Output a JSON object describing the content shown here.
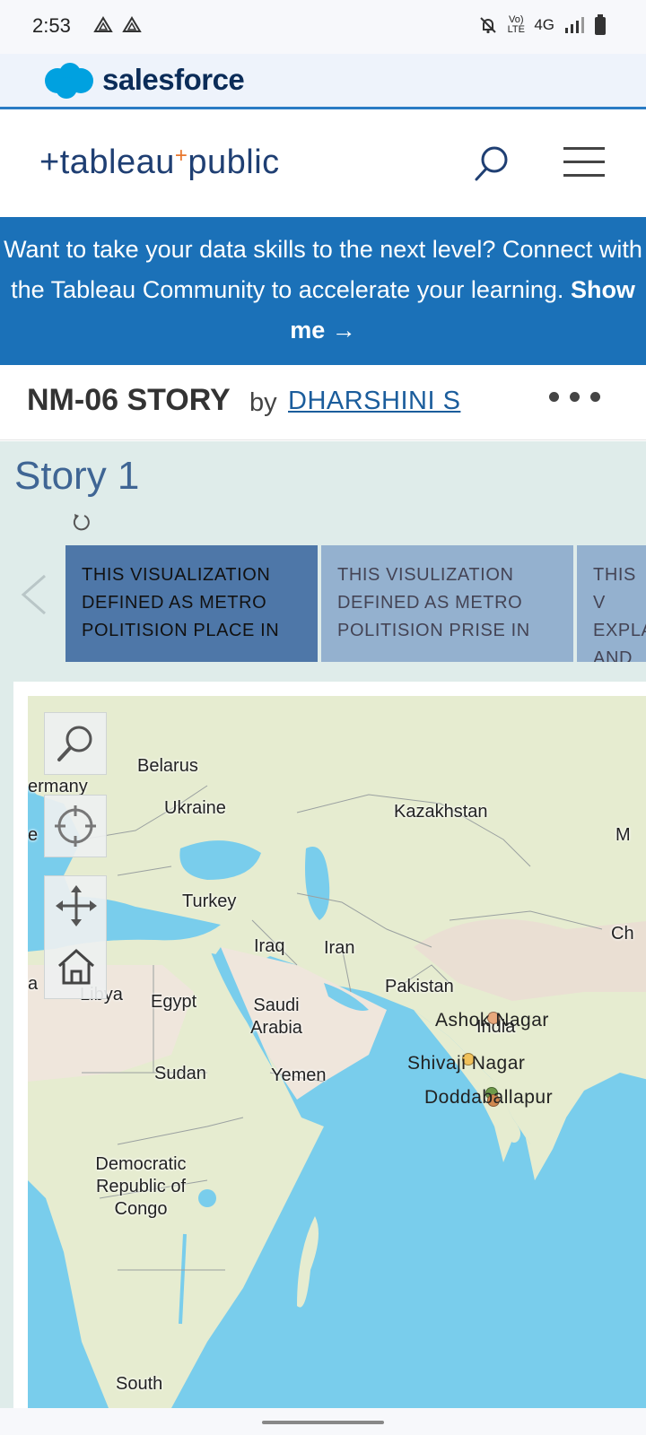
{
  "status_bar": {
    "time": "2:53",
    "network": "4G",
    "volte": "Vo) LTE"
  },
  "salesforce": {
    "brand": "salesforce",
    "color": "#00a1e0"
  },
  "tableau_header": {
    "logo_main": "+tableau",
    "logo_plus": "+",
    "logo_public": "public"
  },
  "banner": {
    "text": "Want to take your data skills to the next level? Connect with the Tableau Community to accelerate your learning.",
    "link_label": "Show me →"
  },
  "viz": {
    "title": "NM-06 STORY",
    "by": "by",
    "author": "DHARSHINI S"
  },
  "story": {
    "title": "Story 1",
    "points": [
      {
        "label": "THIS VISUALIZATION DEFINED AS METRO POLITISION PLACE IN"
      },
      {
        "label": "THIS VISULIZATION DEFINED AS METRO POLITISION PRISE IN"
      },
      {
        "label": "THIS V EXPLA AND P"
      }
    ]
  },
  "map": {
    "countries": [
      "ermany",
      "Belarus",
      "Ukraine",
      "Kazakhstan",
      "M",
      "Turkey",
      "Iraq",
      "Iran",
      "Ch",
      "Pakistan",
      "India",
      "Libya",
      "Egypt",
      "Saudi Arabia",
      "Sudan",
      "Yemen",
      "Democratic Republic of Congo",
      "South",
      "a",
      "e"
    ],
    "places": [
      {
        "name": "Ashok Nagar",
        "color": "#e8a87c"
      },
      {
        "name": "Shivaji Nagar",
        "color": "#f0c15a"
      },
      {
        "name": "Doddaballapur",
        "color": "#6e9a4a"
      }
    ],
    "colors": {
      "water": "#79cdec",
      "land": "#e6ecd0",
      "desert": "#efe6dc"
    }
  },
  "icons": {
    "search": "search-icon",
    "menu": "hamburger-menu-icon",
    "more": "more-dots-icon",
    "undo": "undo-icon",
    "prev": "chevron-left-icon",
    "map_search": "map-search-icon",
    "locate": "crosshair-icon",
    "pan": "pan-arrows-icon",
    "home": "home-icon"
  }
}
